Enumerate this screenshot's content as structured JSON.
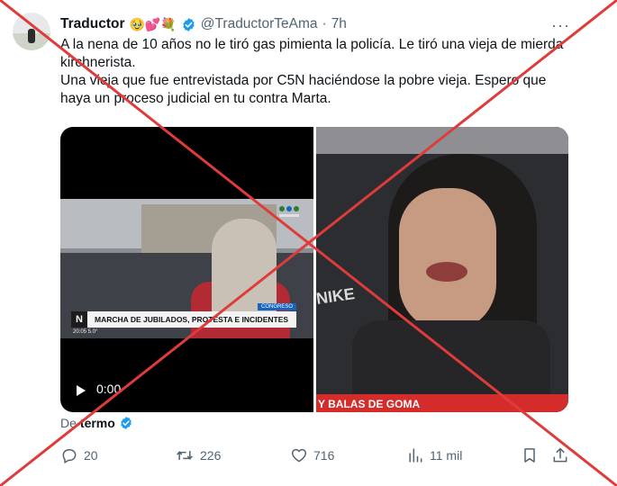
{
  "colors": {
    "accent": "#1d9bf0",
    "muted": "#536471",
    "cross": "#e03b3b"
  },
  "author": {
    "name": "Traductor",
    "emojis": "🥹💕💐",
    "handle": "@TraductorTeAma",
    "separator": "·",
    "time": "7h",
    "more_label": "···"
  },
  "tweet": {
    "paragraph1": "A la nena de 10 años no le tiró gas pimienta la policía. Le tiró una vieja de mierda kirchnerista.",
    "paragraph2": "Una vieja que fue entrevistada por C5N haciéndose la pobre vieja. Espero que haya un proceso judicial en tu contra Marta."
  },
  "media": {
    "video": {
      "headline": "MARCHA DE JUBILADOS, PROTESTA E INCIDENTES",
      "badge": "N",
      "tag": "CONGRESO",
      "clock": "20:05   5.0°",
      "time": "0:00",
      "icons": [
        "play-icon",
        "tn-logo-icon"
      ]
    },
    "photo": {
      "shirt_text": "NIKE",
      "banner": "Y BALAS DE GOMA"
    }
  },
  "from": {
    "prefix": "De",
    "user": "termo"
  },
  "actions": {
    "replies": "20",
    "reposts": "226",
    "likes": "716",
    "views": "11 mil"
  }
}
